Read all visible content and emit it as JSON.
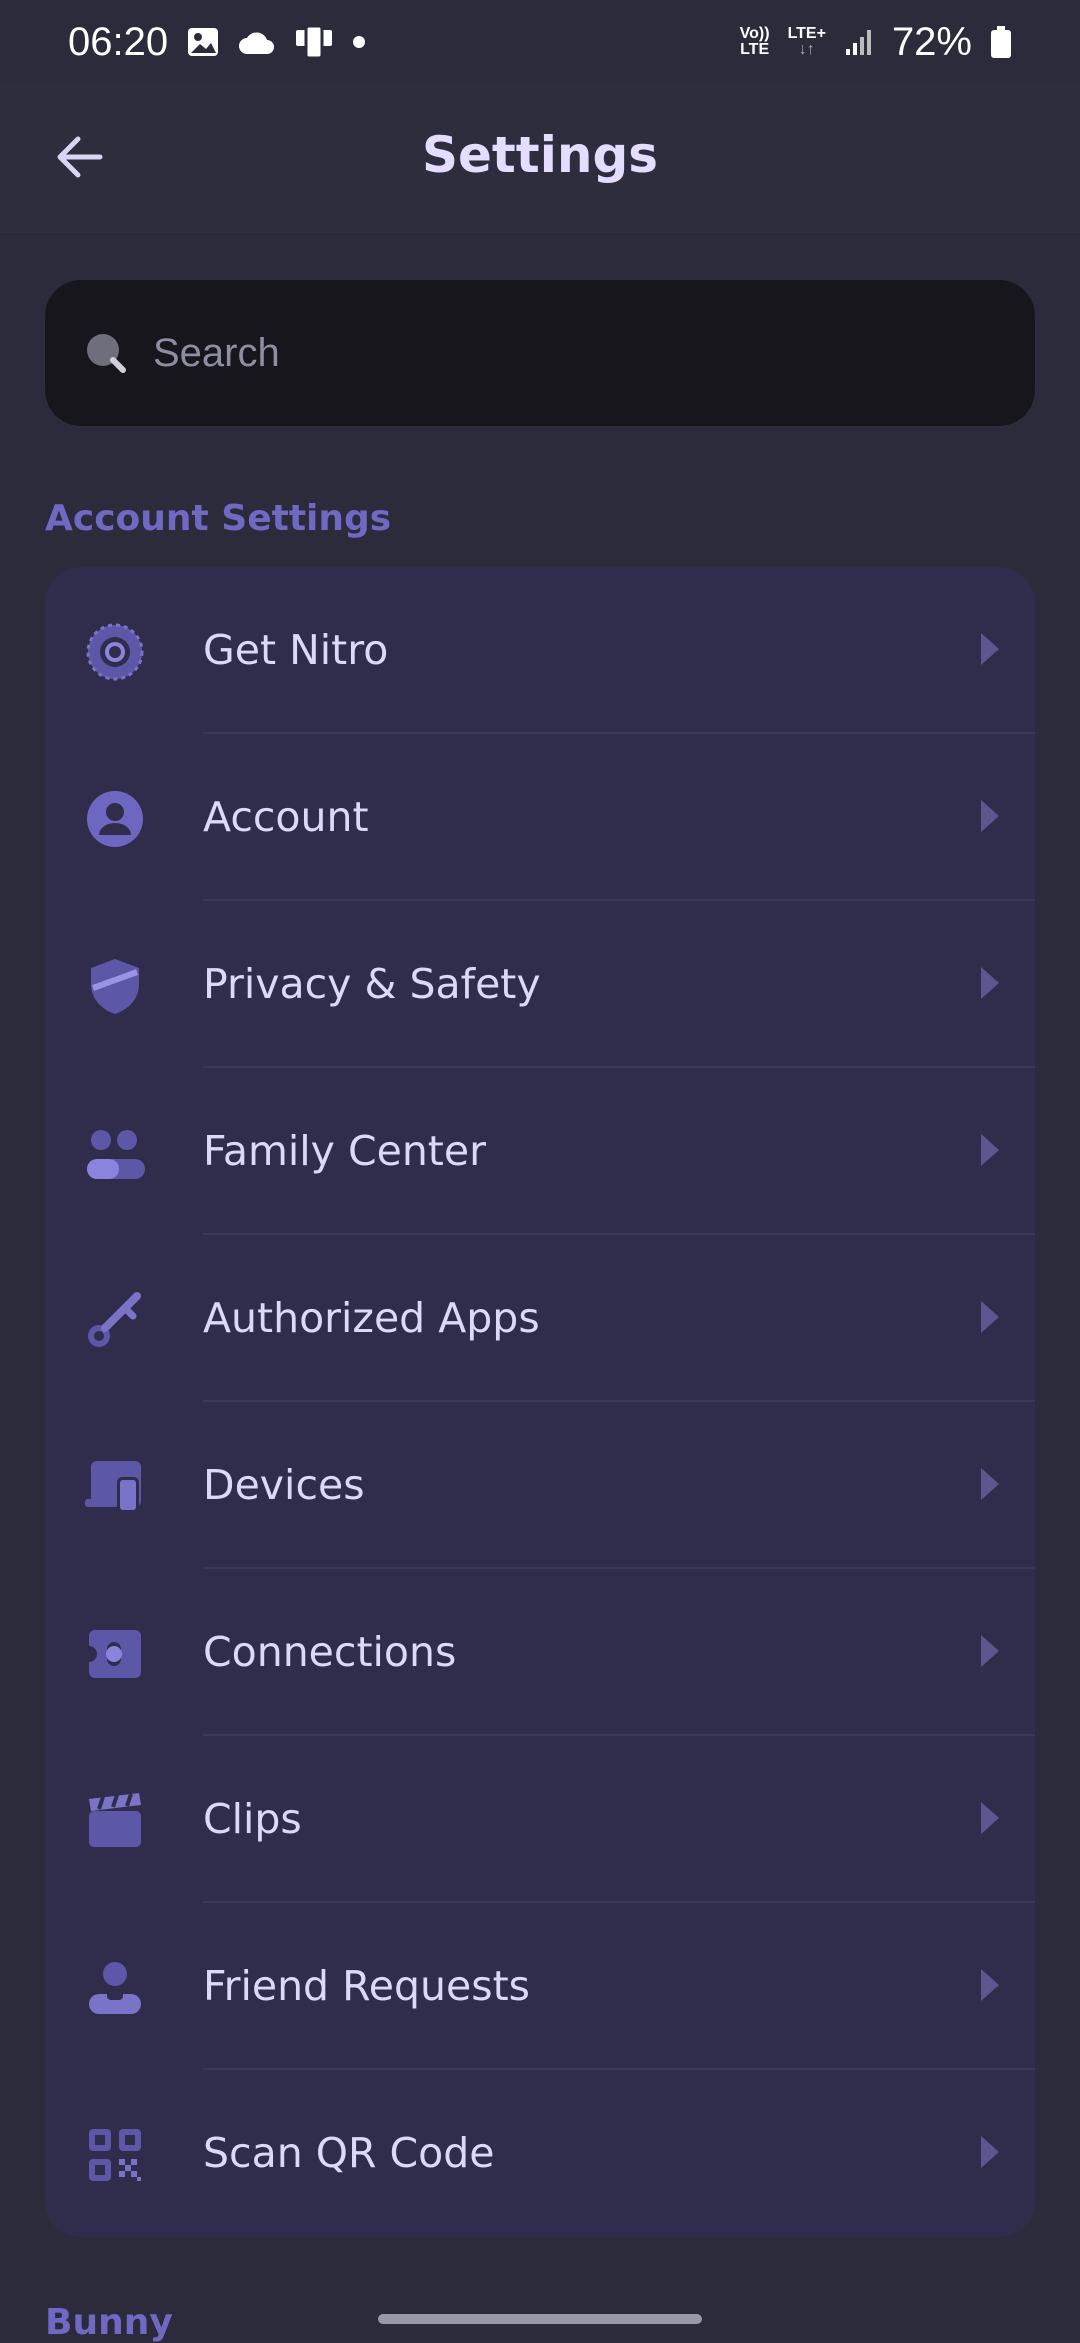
{
  "status_bar": {
    "time": "06:20",
    "volte_top": "Vo))",
    "volte_bottom": "LTE",
    "lte_plus": "LTE+",
    "battery_percent": "72%"
  },
  "header": {
    "title": "Settings"
  },
  "search": {
    "placeholder": "Search"
  },
  "sections": {
    "account_settings_title": "Account Settings",
    "next_section_title": "Bunny"
  },
  "items": [
    {
      "label": "Get Nitro",
      "icon": "nitro-icon"
    },
    {
      "label": "Account",
      "icon": "account-icon"
    },
    {
      "label": "Privacy & Safety",
      "icon": "shield-icon"
    },
    {
      "label": "Family Center",
      "icon": "family-icon"
    },
    {
      "label": "Authorized Apps",
      "icon": "key-icon"
    },
    {
      "label": "Devices",
      "icon": "devices-icon"
    },
    {
      "label": "Connections",
      "icon": "puzzle-icon"
    },
    {
      "label": "Clips",
      "icon": "clapperboard-icon"
    },
    {
      "label": "Friend Requests",
      "icon": "friend-icon"
    },
    {
      "label": "Scan QR Code",
      "icon": "qr-code-icon"
    }
  ],
  "colors": {
    "background": "#2b2b3c",
    "card": "#2f2d4b",
    "accent": "#6f69c4",
    "text": "#dcd9f7"
  }
}
